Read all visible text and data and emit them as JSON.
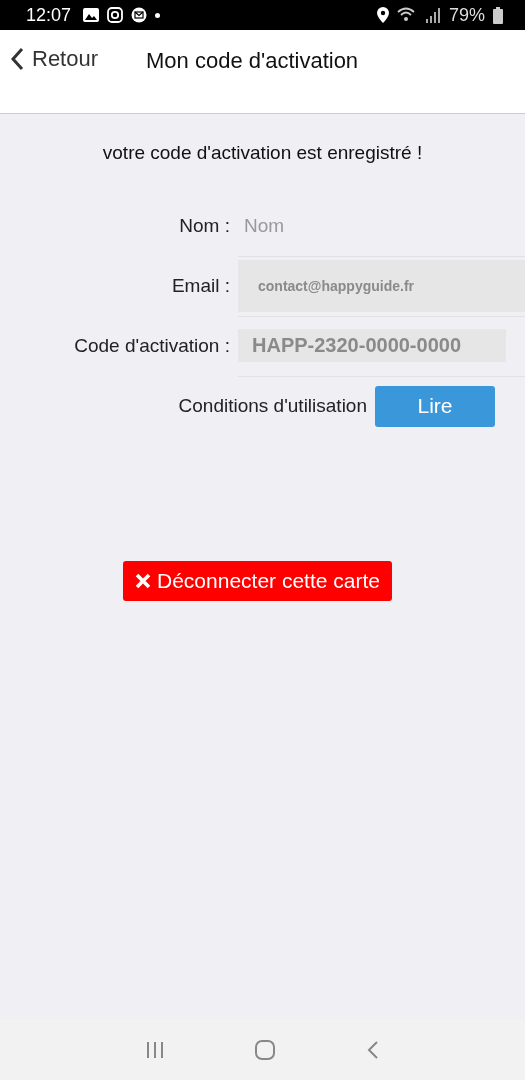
{
  "status_bar": {
    "time": "12:07",
    "battery": "79%"
  },
  "header": {
    "back": "Retour",
    "title": "Mon code d'activation"
  },
  "message": "votre code d'activation est enregistré !",
  "fields": [
    {
      "label": "Nom :",
      "placeholder": "Nom",
      "disabled": false,
      "kind": "name"
    },
    {
      "label": "Email :",
      "value": "contact@happyguide.fr",
      "disabled": true,
      "kind": "email"
    },
    {
      "label": "Code d'activation :",
      "value": "HAPP-2320-0000-0000",
      "disabled": true,
      "kind": "code"
    }
  ],
  "terms": {
    "label": "Conditions d'utilisation",
    "button": "Lire"
  },
  "disconnect_button": "Déconnecter cette carte"
}
